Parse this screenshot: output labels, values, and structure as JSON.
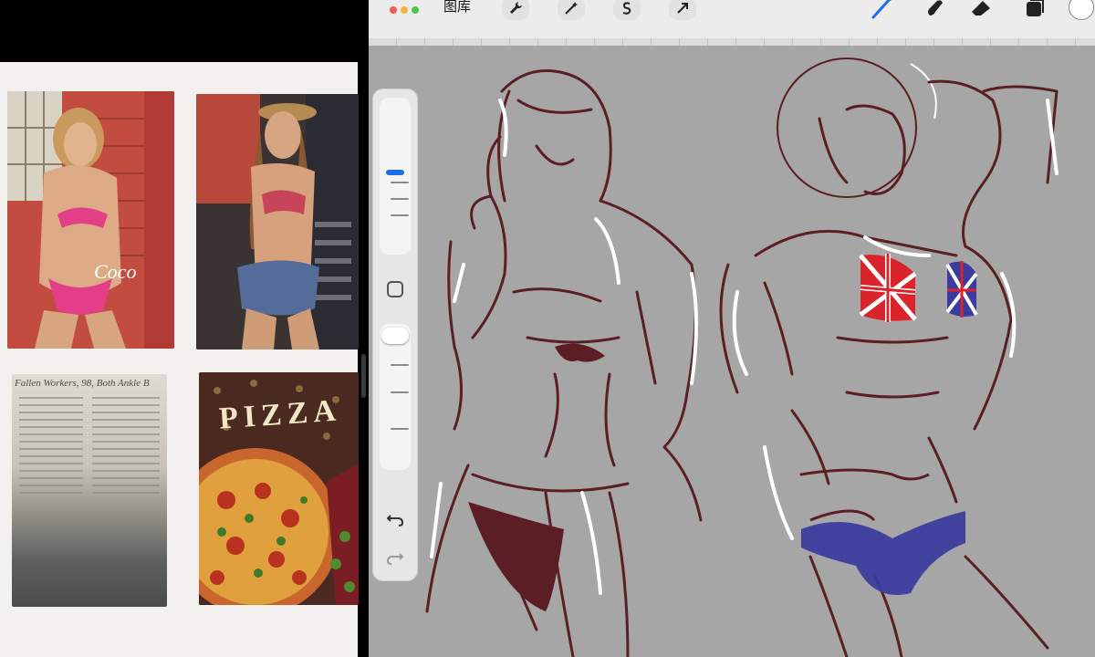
{
  "toolbar": {
    "gallery_label": "图库",
    "tools_left": [
      "wrench-icon",
      "magic-wand-icon",
      "selection-s-icon",
      "move-arrow-icon"
    ],
    "tools_right": [
      "brush-icon",
      "smudge-icon",
      "eraser-icon",
      "layers-icon"
    ],
    "active_tool": "brush",
    "accent_color": "#1b6fe8",
    "current_color": "#ffffff"
  },
  "reference_panel": {
    "clipping_headline": "Fallen Workers, 98, Both Ankle B",
    "pizza_label": "PIZZA"
  },
  "sidebar": {
    "brush_size_level": 0.45,
    "opacity_level": 1.0
  },
  "canvas": {
    "background_color": "#a6a6a6",
    "line_color": "#5a1e24",
    "highlight_color": "#ffffff",
    "flag_red": "#d9242b",
    "flag_blue": "#3c3c9e"
  }
}
